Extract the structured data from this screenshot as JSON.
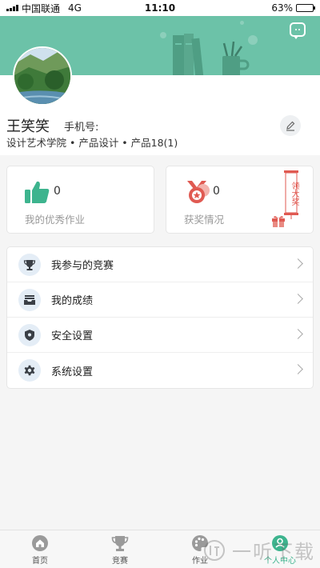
{
  "status_bar": {
    "carrier": "中国联通",
    "network": "4G",
    "time": "11:10",
    "battery_text": "63%",
    "battery_level": 0.63
  },
  "profile": {
    "name": "王笑笑",
    "phone_label": "手机号:",
    "school": "设计艺术学院 • 产品设计 • 产品18(1)"
  },
  "stats": {
    "works": {
      "count": "0",
      "label": "我的优秀作业",
      "icon": "thumbs-up-icon"
    },
    "awards": {
      "count": "0",
      "label": "获奖情况",
      "icon": "medal-icon",
      "promo_text": "领大奖"
    }
  },
  "menu": [
    {
      "label": "我参与的竞赛",
      "icon": "trophy-icon"
    },
    {
      "label": "我的成绩",
      "icon": "inbox-icon"
    },
    {
      "label": "安全设置",
      "icon": "shield-icon"
    },
    {
      "label": "系统设置",
      "icon": "gear-icon"
    }
  ],
  "tabs": [
    {
      "label": "首页",
      "icon": "home-icon"
    },
    {
      "label": "竞赛",
      "icon": "trophy-icon"
    },
    {
      "label": "作业",
      "icon": "palette-icon"
    },
    {
      "label": "个人中心",
      "icon": "person-icon",
      "active": true
    }
  ],
  "watermark": {
    "text": "一听下载"
  },
  "colors": {
    "brand": "#6cc2a8",
    "accent_green": "#3db48e",
    "award_red": "#e05a52"
  }
}
